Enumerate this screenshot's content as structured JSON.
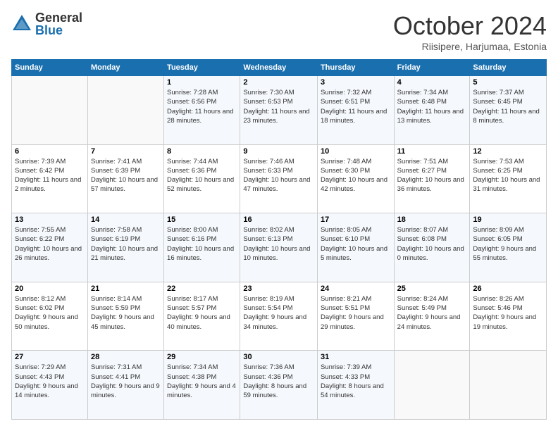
{
  "logo": {
    "general": "General",
    "blue": "Blue"
  },
  "header": {
    "month": "October 2024",
    "location": "Riisipere, Harjumaa, Estonia"
  },
  "weekdays": [
    "Sunday",
    "Monday",
    "Tuesday",
    "Wednesday",
    "Thursday",
    "Friday",
    "Saturday"
  ],
  "weeks": [
    [
      {
        "day": "",
        "info": ""
      },
      {
        "day": "",
        "info": ""
      },
      {
        "day": "1",
        "info": "Sunrise: 7:28 AM\nSunset: 6:56 PM\nDaylight: 11 hours and 28 minutes."
      },
      {
        "day": "2",
        "info": "Sunrise: 7:30 AM\nSunset: 6:53 PM\nDaylight: 11 hours and 23 minutes."
      },
      {
        "day": "3",
        "info": "Sunrise: 7:32 AM\nSunset: 6:51 PM\nDaylight: 11 hours and 18 minutes."
      },
      {
        "day": "4",
        "info": "Sunrise: 7:34 AM\nSunset: 6:48 PM\nDaylight: 11 hours and 13 minutes."
      },
      {
        "day": "5",
        "info": "Sunrise: 7:37 AM\nSunset: 6:45 PM\nDaylight: 11 hours and 8 minutes."
      }
    ],
    [
      {
        "day": "6",
        "info": "Sunrise: 7:39 AM\nSunset: 6:42 PM\nDaylight: 11 hours and 2 minutes."
      },
      {
        "day": "7",
        "info": "Sunrise: 7:41 AM\nSunset: 6:39 PM\nDaylight: 10 hours and 57 minutes."
      },
      {
        "day": "8",
        "info": "Sunrise: 7:44 AM\nSunset: 6:36 PM\nDaylight: 10 hours and 52 minutes."
      },
      {
        "day": "9",
        "info": "Sunrise: 7:46 AM\nSunset: 6:33 PM\nDaylight: 10 hours and 47 minutes."
      },
      {
        "day": "10",
        "info": "Sunrise: 7:48 AM\nSunset: 6:30 PM\nDaylight: 10 hours and 42 minutes."
      },
      {
        "day": "11",
        "info": "Sunrise: 7:51 AM\nSunset: 6:27 PM\nDaylight: 10 hours and 36 minutes."
      },
      {
        "day": "12",
        "info": "Sunrise: 7:53 AM\nSunset: 6:25 PM\nDaylight: 10 hours and 31 minutes."
      }
    ],
    [
      {
        "day": "13",
        "info": "Sunrise: 7:55 AM\nSunset: 6:22 PM\nDaylight: 10 hours and 26 minutes."
      },
      {
        "day": "14",
        "info": "Sunrise: 7:58 AM\nSunset: 6:19 PM\nDaylight: 10 hours and 21 minutes."
      },
      {
        "day": "15",
        "info": "Sunrise: 8:00 AM\nSunset: 6:16 PM\nDaylight: 10 hours and 16 minutes."
      },
      {
        "day": "16",
        "info": "Sunrise: 8:02 AM\nSunset: 6:13 PM\nDaylight: 10 hours and 10 minutes."
      },
      {
        "day": "17",
        "info": "Sunrise: 8:05 AM\nSunset: 6:10 PM\nDaylight: 10 hours and 5 minutes."
      },
      {
        "day": "18",
        "info": "Sunrise: 8:07 AM\nSunset: 6:08 PM\nDaylight: 10 hours and 0 minutes."
      },
      {
        "day": "19",
        "info": "Sunrise: 8:09 AM\nSunset: 6:05 PM\nDaylight: 9 hours and 55 minutes."
      }
    ],
    [
      {
        "day": "20",
        "info": "Sunrise: 8:12 AM\nSunset: 6:02 PM\nDaylight: 9 hours and 50 minutes."
      },
      {
        "day": "21",
        "info": "Sunrise: 8:14 AM\nSunset: 5:59 PM\nDaylight: 9 hours and 45 minutes."
      },
      {
        "day": "22",
        "info": "Sunrise: 8:17 AM\nSunset: 5:57 PM\nDaylight: 9 hours and 40 minutes."
      },
      {
        "day": "23",
        "info": "Sunrise: 8:19 AM\nSunset: 5:54 PM\nDaylight: 9 hours and 34 minutes."
      },
      {
        "day": "24",
        "info": "Sunrise: 8:21 AM\nSunset: 5:51 PM\nDaylight: 9 hours and 29 minutes."
      },
      {
        "day": "25",
        "info": "Sunrise: 8:24 AM\nSunset: 5:49 PM\nDaylight: 9 hours and 24 minutes."
      },
      {
        "day": "26",
        "info": "Sunrise: 8:26 AM\nSunset: 5:46 PM\nDaylight: 9 hours and 19 minutes."
      }
    ],
    [
      {
        "day": "27",
        "info": "Sunrise: 7:29 AM\nSunset: 4:43 PM\nDaylight: 9 hours and 14 minutes."
      },
      {
        "day": "28",
        "info": "Sunrise: 7:31 AM\nSunset: 4:41 PM\nDaylight: 9 hours and 9 minutes."
      },
      {
        "day": "29",
        "info": "Sunrise: 7:34 AM\nSunset: 4:38 PM\nDaylight: 9 hours and 4 minutes."
      },
      {
        "day": "30",
        "info": "Sunrise: 7:36 AM\nSunset: 4:36 PM\nDaylight: 8 hours and 59 minutes."
      },
      {
        "day": "31",
        "info": "Sunrise: 7:39 AM\nSunset: 4:33 PM\nDaylight: 8 hours and 54 minutes."
      },
      {
        "day": "",
        "info": ""
      },
      {
        "day": "",
        "info": ""
      }
    ]
  ]
}
